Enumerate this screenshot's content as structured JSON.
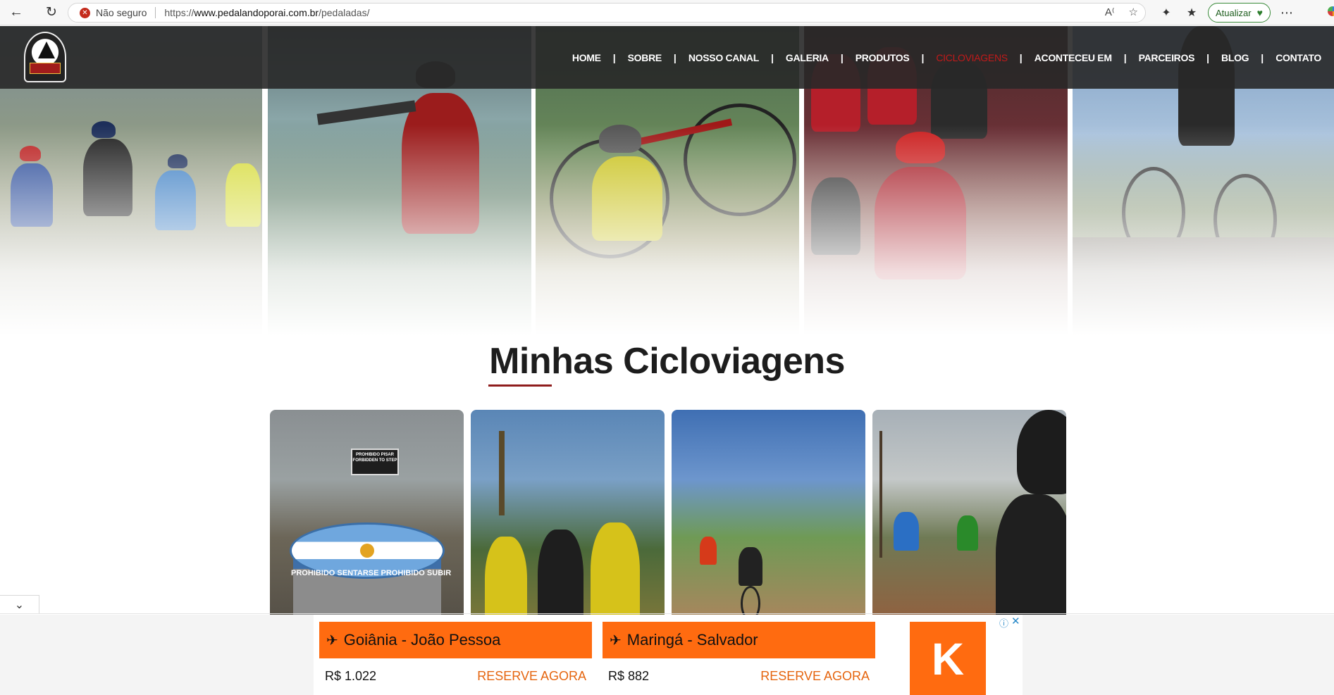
{
  "browser": {
    "security_label": "Não seguro",
    "url_prefix": "https://",
    "url_host": "www.pedalandoporai.com.br",
    "url_path": "/pedaladas/",
    "update_label": "Atualizar"
  },
  "site": {
    "nav": [
      {
        "label": "HOME",
        "active": false
      },
      {
        "label": "SOBRE",
        "active": false
      },
      {
        "label": "NOSSO CANAL",
        "active": false
      },
      {
        "label": "GALERIA",
        "active": false
      },
      {
        "label": "PRODUTOS",
        "active": false
      },
      {
        "label": "CICLOVIAGENS",
        "active": true
      },
      {
        "label": "ACONTECEU EM",
        "active": false
      },
      {
        "label": "PARCEIROS",
        "active": false
      },
      {
        "label": "BLOG",
        "active": false
      },
      {
        "label": "CONTATO",
        "active": false
      }
    ],
    "nav_separator": "|",
    "active_color": "#c21a1a"
  },
  "section": {
    "title": "Minhas Cicloviagens",
    "underline_color": "#8f1d1d"
  },
  "gallery": {
    "sign_text": "PROHIBIDO PISAR FORBIDDEN TO STEP",
    "stand_text": "PROHIBIDO SENTARSE  PROHIBIDO SUBIR"
  },
  "ad": {
    "cards": [
      {
        "route": "Goiânia - João Pessoa",
        "price": "R$ 1.022",
        "cta": "RESERVE AGORA"
      },
      {
        "route": "Maringá - Salvador",
        "price": "R$ 882",
        "cta": "RESERVE AGORA"
      }
    ],
    "logo_letter": "K",
    "info_icon": "ⓘ",
    "close_icon": "✕",
    "accent": "#ff6b10"
  }
}
